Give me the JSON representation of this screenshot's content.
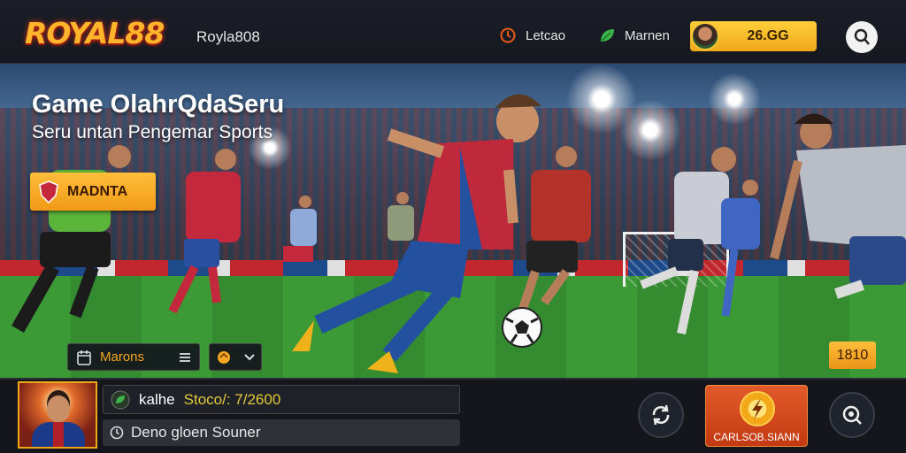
{
  "header": {
    "logo_text": "ROYAL88",
    "brand_text": "Royla808",
    "nav": [
      {
        "label": "Letcao",
        "icon": "clock-icon"
      },
      {
        "label": "Marnen",
        "icon": "leaf-icon"
      }
    ],
    "balance": "26.GG"
  },
  "hero": {
    "title": "Game OlahrQdaSeru",
    "subtitle": "Seru untan Pengemar Sports",
    "cta_label": "MADNTA",
    "filter_label": "Marons",
    "score_badge": "1810"
  },
  "bottom": {
    "player_name": "kalhe",
    "player_score": "Stoco/: 7/2600",
    "status_text": "Deno gloen Souner",
    "bet_label": "CARLSOB.SIANN"
  },
  "colors": {
    "accent": "#f5a623",
    "cta": "#f09a18",
    "bet": "#c33a12",
    "background": "#14161c"
  }
}
